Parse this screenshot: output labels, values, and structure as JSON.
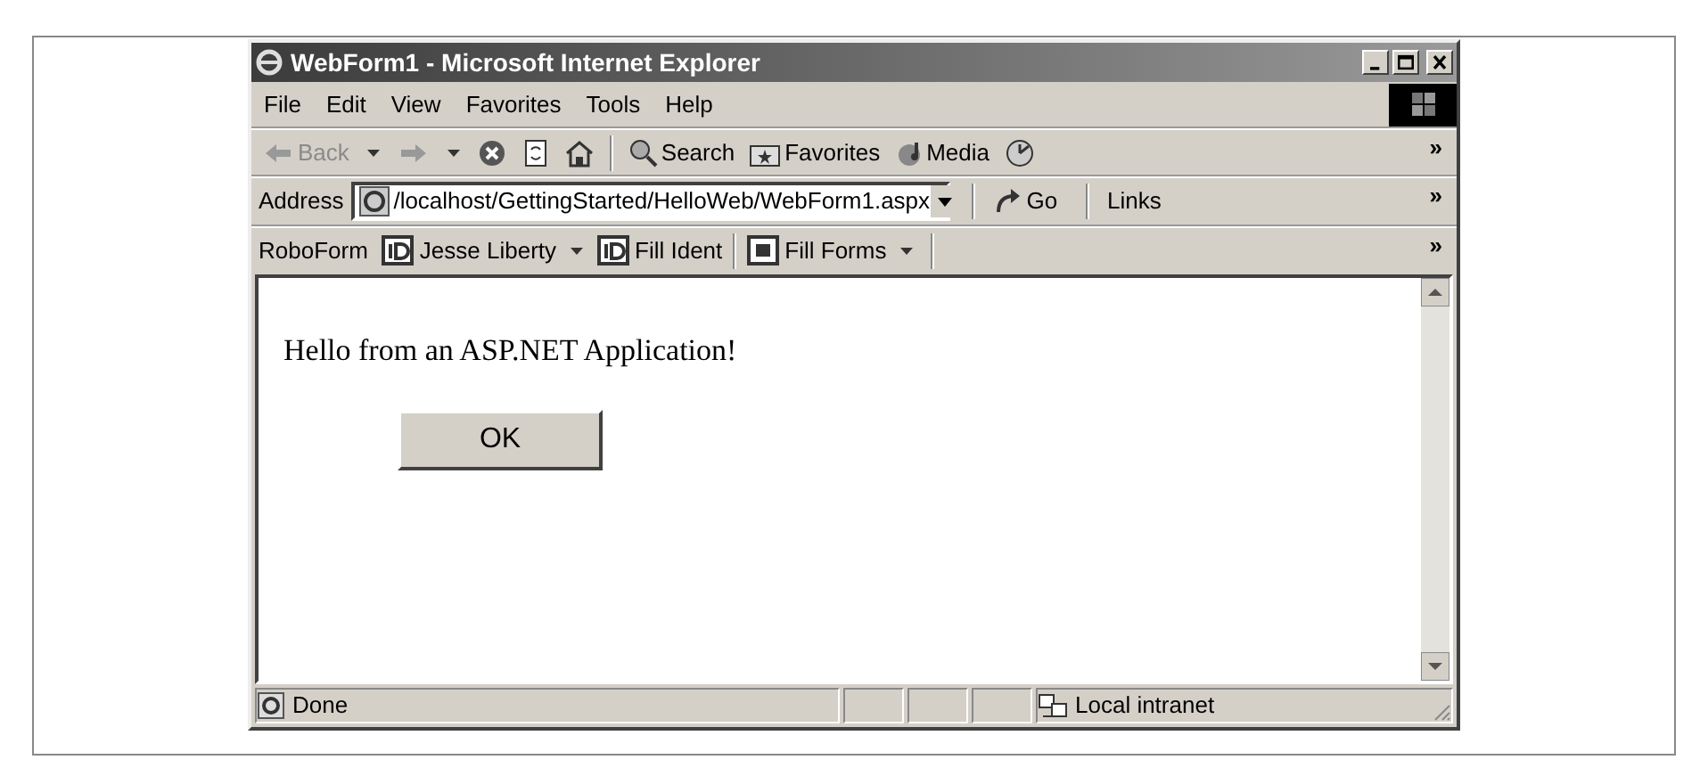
{
  "window": {
    "title": "WebForm1 - Microsoft Internet Explorer"
  },
  "menu": [
    "File",
    "Edit",
    "View",
    "Favorites",
    "Tools",
    "Help"
  ],
  "toolbar": {
    "items": [
      {
        "kind": "back",
        "label": "Back",
        "disabled": true,
        "dropdown": true
      },
      {
        "kind": "forward",
        "disabled": true,
        "dropdown": true
      },
      {
        "kind": "stop"
      },
      {
        "kind": "refresh"
      },
      {
        "kind": "home"
      },
      {
        "kind": "separator"
      },
      {
        "kind": "search",
        "label": "Search"
      },
      {
        "kind": "favorites",
        "label": "Favorites"
      },
      {
        "kind": "media",
        "label": "Media"
      },
      {
        "kind": "history"
      }
    ],
    "chevron": "»"
  },
  "address_bar": {
    "label": "Address",
    "value": "/localhost/GettingStarted/HelloWeb/WebForm1.aspx",
    "go": "Go",
    "links": "Links",
    "chevron": "»"
  },
  "roboform": {
    "label": "RoboForm",
    "items": [
      {
        "kind": "identity",
        "label": "Jesse Liberty",
        "dropdown": true
      },
      {
        "kind": "identity",
        "label": "Fill Ident",
        "dropdown": false
      },
      {
        "kind": "separator"
      },
      {
        "kind": "forms",
        "label": "Fill Forms",
        "dropdown": true
      }
    ],
    "chevron": "»"
  },
  "content": {
    "text": "Hello from an ASP.NET Application!",
    "button": "OK"
  },
  "status_bar": {
    "text": "Done",
    "zone": "Local intranet"
  }
}
